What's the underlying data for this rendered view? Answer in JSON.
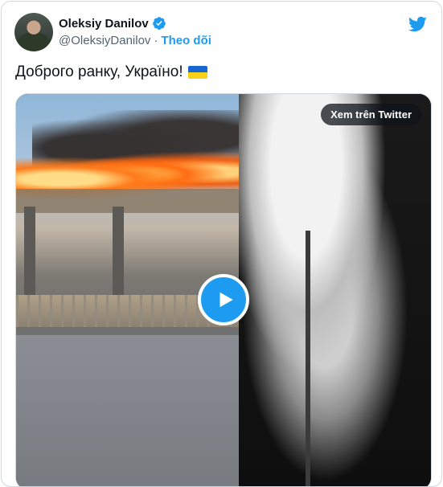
{
  "tweet": {
    "author_name": "Oleksiy Danilov",
    "handle": "@OleksiyDanilov",
    "separator": "·",
    "follow_label": "Theo dõi",
    "text": "Доброго ранку, Україно!"
  },
  "media": {
    "watch_label": "Xem trên Twitter"
  },
  "colors": {
    "accent": "#1d9bf0",
    "text": "#0f1419",
    "muted": "#536471",
    "border": "#cfd9de"
  },
  "icons": {
    "verified": "verified-badge-icon",
    "brand": "twitter-bird-icon",
    "flag": "ukraine-flag-icon",
    "play": "play-icon"
  }
}
